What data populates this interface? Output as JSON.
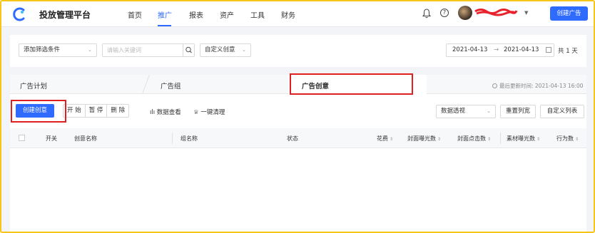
{
  "app": {
    "title": "投放管理平台"
  },
  "nav": [
    {
      "label": "首页",
      "active": false
    },
    {
      "label": "推广",
      "active": true
    },
    {
      "label": "报表",
      "active": false
    },
    {
      "label": "资产",
      "active": false
    },
    {
      "label": "工具",
      "active": false
    },
    {
      "label": "财务",
      "active": false
    }
  ],
  "header_actions": {
    "help_label": "?",
    "create_ad_label": "创建广告"
  },
  "filters": {
    "add_filter_label": "添加筛选条件",
    "search_placeholder": "请输入关键词",
    "custom_creative_label": "自定义创意",
    "date_start": "2021-04-13",
    "date_arrow": "→",
    "date_end": "2021-04-13",
    "day_count": "共 1 天"
  },
  "tabs": [
    {
      "label": "广告计划",
      "active": false
    },
    {
      "label": "广告组",
      "active": false
    },
    {
      "label": "广告创意",
      "active": true
    }
  ],
  "last_updated": "最后更新时间: 2021-04-13 16:00",
  "toolbar": {
    "create_label": "创建创意",
    "start_label": "开 始",
    "pause_label": "暂 停",
    "delete_label": "删 除",
    "data_view_label": "数据查看",
    "one_click_clean_label": "一键清理",
    "data_pivot_label": "数据透视",
    "reset_columns_label": "重置列宽",
    "custom_columns_label": "自定义列表"
  },
  "table": {
    "columns": [
      {
        "label": "开关",
        "sortable": false
      },
      {
        "label": "创意名称",
        "sortable": false
      },
      {
        "label": "组名称",
        "sortable": false
      },
      {
        "label": "状态",
        "sortable": false
      },
      {
        "label": "花费",
        "sortable": true
      },
      {
        "label": "封面曝光数",
        "sortable": true
      },
      {
        "label": "封面点击数",
        "sortable": true
      },
      {
        "label": "素材曝光数",
        "sortable": true
      },
      {
        "label": "行为数",
        "sortable": true
      }
    ],
    "rows": []
  },
  "colors": {
    "accent": "#2f6bff",
    "highlight_box": "#e02020",
    "frame": "#f5c518"
  },
  "icons": [
    "logo-icon",
    "bell-icon",
    "help-icon",
    "chevron-down-icon",
    "search-icon",
    "calendar-icon",
    "clock-icon",
    "chart-icon",
    "broom-icon",
    "sort-icon"
  ]
}
